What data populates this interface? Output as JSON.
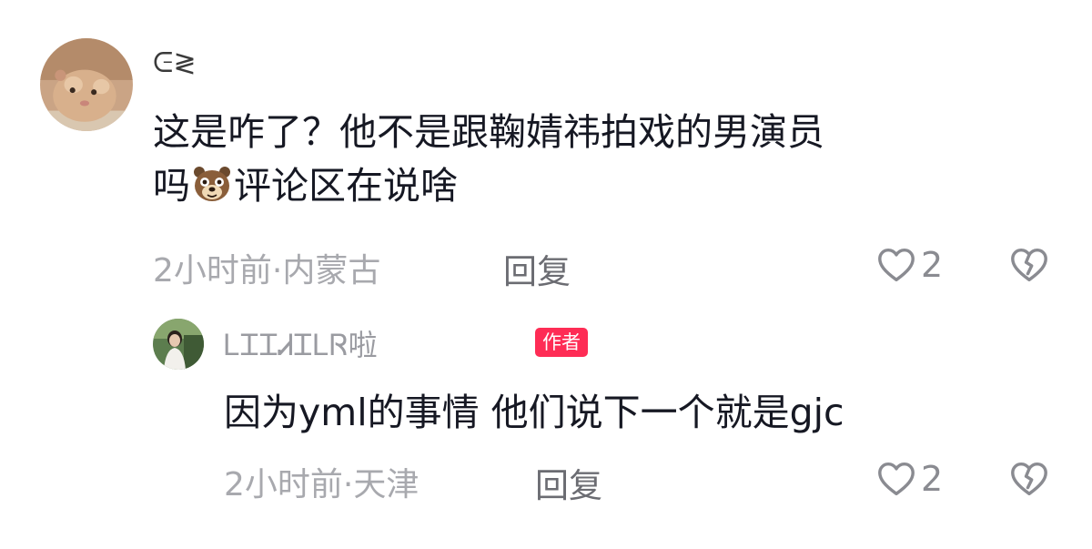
{
  "comments": [
    {
      "username": "ᕮ≷",
      "text_line1": "这是咋了？他不是跟鞠婧祎拍戏的男演员",
      "text_line2_prefix": "吗",
      "emoji": "bear-emoji",
      "text_line2_suffix": "评论区在说啥",
      "time": "2小时前",
      "location": "内蒙古",
      "meta_sep": "·",
      "reply_label": "回复",
      "like_count": "2"
    },
    {
      "username": "ᏞᏆᏆᏗᏆᏞᏒ啦",
      "author_badge": "作者",
      "text": "因为yml的事情 他们说下一个就是gjc",
      "time": "2小时前",
      "location": "天津",
      "meta_sep": "·",
      "reply_label": "回复",
      "like_count": "2"
    }
  ],
  "colors": {
    "author_badge": "#fe2c55",
    "text": "#161823",
    "meta": "#a8a9ae"
  }
}
